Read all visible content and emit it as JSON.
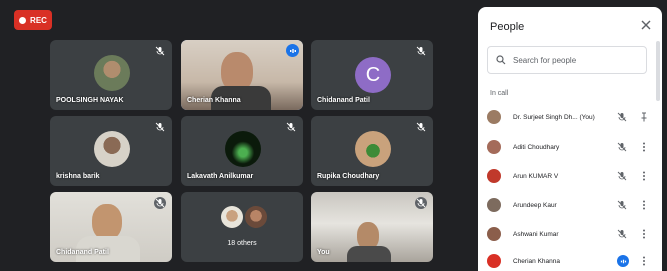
{
  "rec": {
    "label": "REC",
    "color": "#d93025"
  },
  "tiles": [
    {
      "name": "POOLSINGH NAYAK",
      "muted": true
    },
    {
      "name": "Cherian Khanna",
      "muted": false,
      "speaking": true
    },
    {
      "name": "Chidanand Patil",
      "muted": true,
      "initial": "C"
    },
    {
      "name": "krishna barik",
      "muted": true
    },
    {
      "name": "Lakavath Anilkumar",
      "muted": true
    },
    {
      "name": "Rupika Choudhary",
      "muted": true
    },
    {
      "name": "Chidanand Patil",
      "muted": true
    },
    {
      "name": "",
      "others": "18 others"
    },
    {
      "name": "You",
      "muted": true
    }
  ],
  "panel": {
    "title": "People",
    "search_placeholder": "Search for people",
    "section": "In call",
    "participants": [
      {
        "name": "Dr. Surjeet Singh Dh... (You)",
        "muted": true,
        "icon": "pin-icon"
      },
      {
        "name": "Aditi Choudhary",
        "muted": true,
        "icon": "more-icon"
      },
      {
        "name": "Arun KUMAR V",
        "muted": true,
        "icon": "more-icon"
      },
      {
        "name": "Arundeep Kaur",
        "muted": true,
        "icon": "more-icon"
      },
      {
        "name": "Ashwani Kumar",
        "muted": true,
        "icon": "more-icon"
      },
      {
        "name": "Cherian Khanna",
        "muted": false,
        "icon": "more-icon"
      }
    ]
  },
  "colors": {
    "background": "#202124",
    "tile": "#3c4043",
    "accent": "#1a73e8",
    "avatar_purple": "#8e6cc6"
  }
}
